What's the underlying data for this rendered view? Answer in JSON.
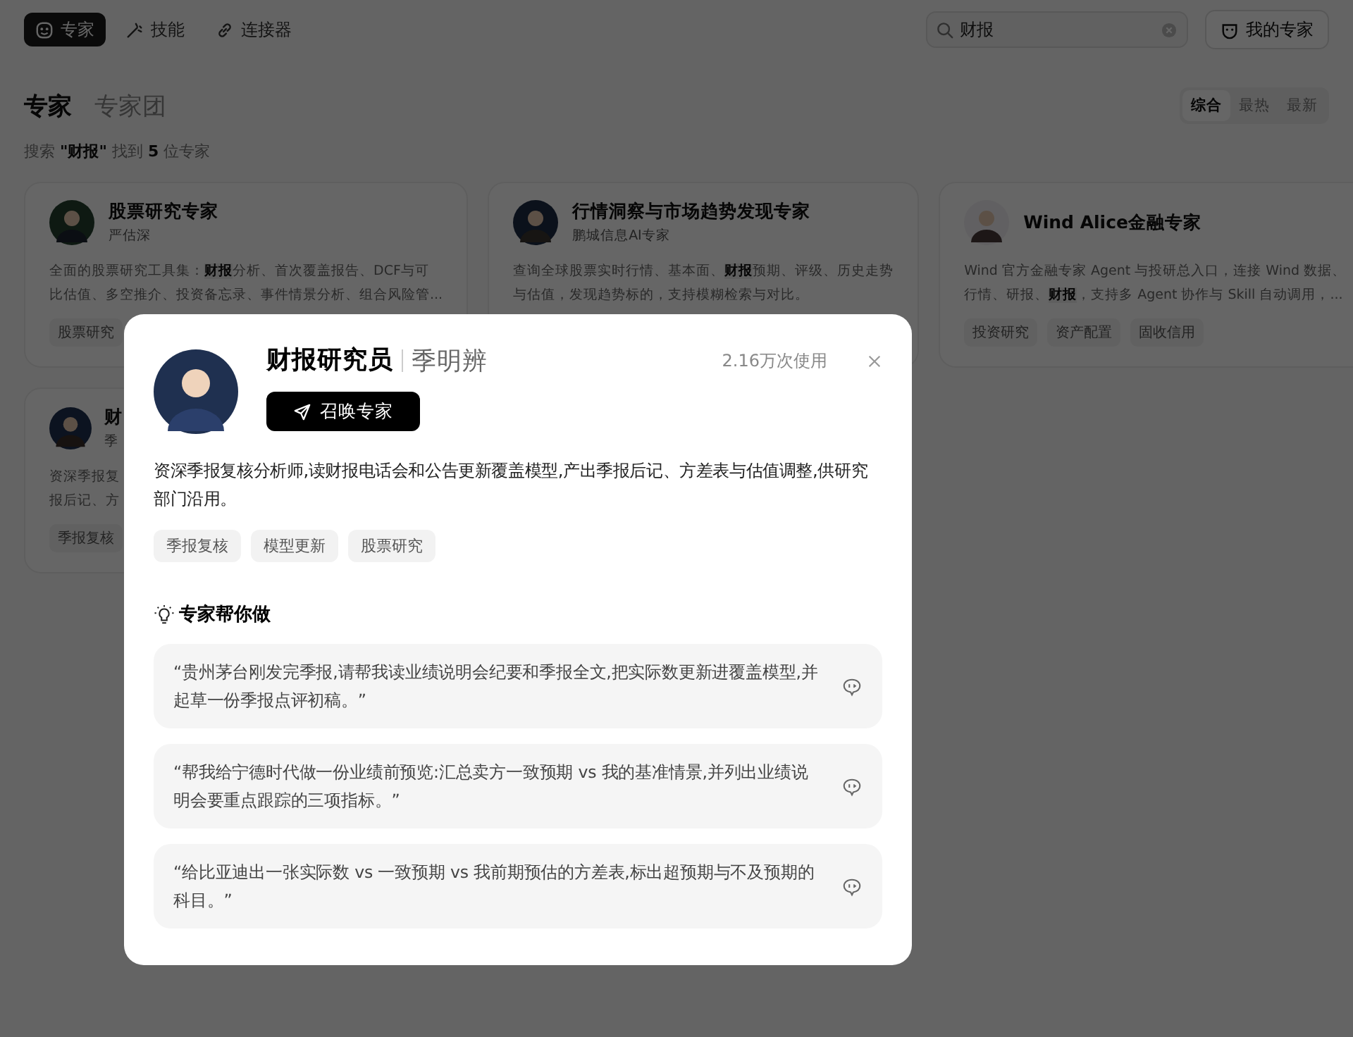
{
  "nav": {
    "tabs": [
      {
        "label": "专家",
        "selected": true
      },
      {
        "label": "技能",
        "selected": false
      },
      {
        "label": "连接器",
        "selected": false
      }
    ],
    "search": {
      "value": "财报"
    },
    "my_experts_button": "我的专家"
  },
  "heading_tabs": [
    {
      "label": "专家",
      "selected": true
    },
    {
      "label": "专家团",
      "selected": false
    }
  ],
  "sort_options": [
    {
      "label": "综合",
      "selected": true
    },
    {
      "label": "最热",
      "selected": false
    },
    {
      "label": "最新",
      "selected": false
    }
  ],
  "result_summary": "搜索 **\"财报\"** 找到 **5** 位专家",
  "cards": [
    {
      "title": "股票研究专家",
      "subtitle": "严估深",
      "description_lines": [
        "全面的股票研究工具集：**财报**分析、首次覆盖报告、DCF与可",
        "比估值、多空推介、投资备忘录、事件情景分析、组合风险管..."
      ],
      "tags": [
        "股票研究"
      ]
    },
    {
      "title": "行情洞察与市场趋势发现专家",
      "subtitle": "鹏城信息AI专家",
      "description_lines": [
        "查询全球股票实时行情、基本面、**财报**预期、评级、历史走势",
        "与估值，发现趋势标的，支持模糊检索与对比。"
      ]
    },
    {
      "title": "Wind Alice金融专家",
      "description_lines": [
        "Wind 官方金融专家 Agent 与投研总入口，连接 Wind 数据、",
        "行情、研报、**财报**，支持多 Agent 协作与 Skill 自动调用，..."
      ],
      "tags": [
        "投资研究",
        "资产配置",
        "固收信用"
      ]
    },
    {
      "title": "财",
      "subtitle": "季",
      "description_lines": [
        "资深季报复",
        "报后记、方"
      ],
      "tags": [
        "季报复核"
      ]
    }
  ],
  "modal": {
    "title": "财报研究员",
    "name": "季明辨",
    "usage": "2.16万次使用",
    "summon_button": "召唤专家",
    "description": "资深季报复核分析师,读财报电话会和公告更新覆盖模型,产出季报后记、方差表与估值调整,供研究部门沿用。",
    "tags": [
      "季报复核",
      "模型更新",
      "股票研究"
    ],
    "section_title": "专家帮你做",
    "prompts": [
      "“贵州茅台刚发完季报,请帮我读业绩说明会纪要和季报全文,把实际数更新进覆盖模型,并起草一份季报点评初稿。”",
      "“帮我给宁德时代做一份业绩前预览:汇总卖方一致预期 vs 我的基准情景,并列出业绩说明会要重点跟踪的三项指标。”",
      "“给比亚迪出一张实际数 vs 一致预期 vs 我前期预估的方差表,标出超预期与不及预期的科目。”"
    ]
  }
}
